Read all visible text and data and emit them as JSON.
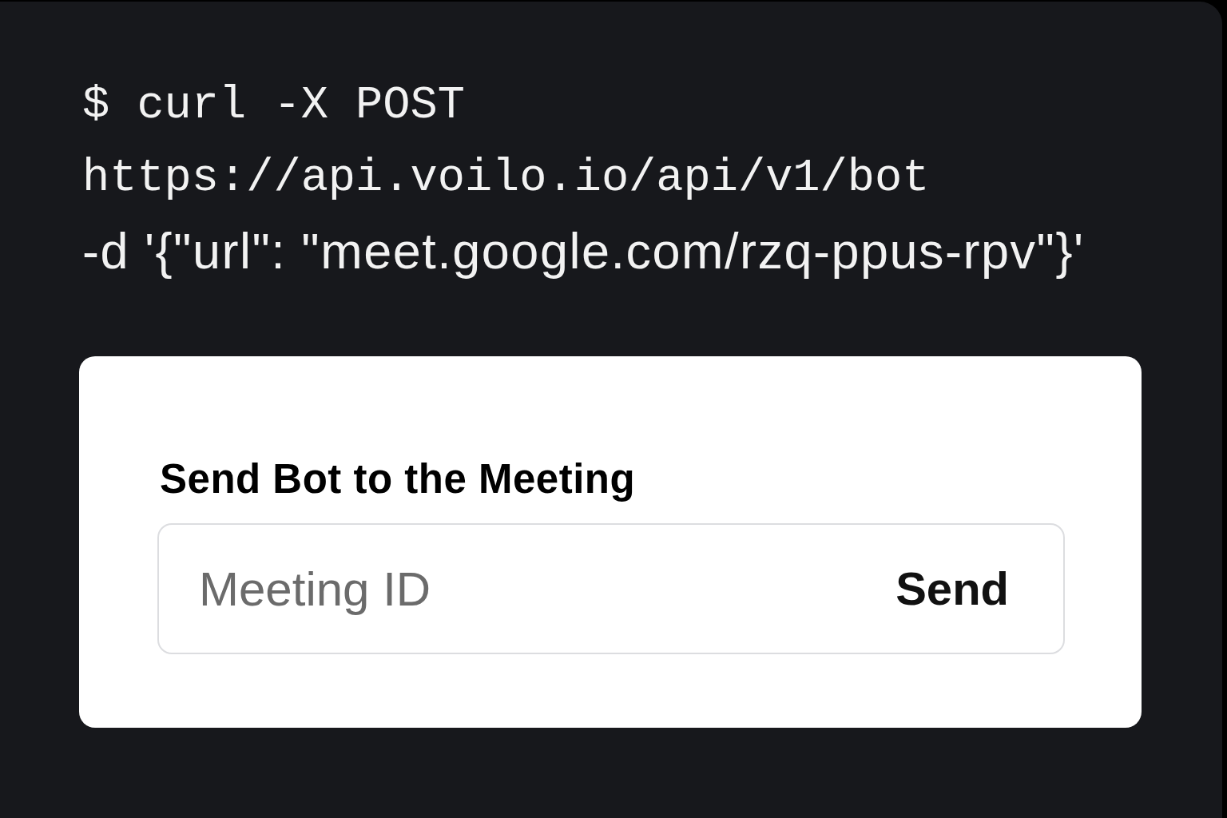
{
  "code": {
    "lines": [
      {
        "kind": "mono",
        "text": "$ curl -X POST"
      },
      {
        "kind": "mono",
        "text": "https://api.voilo.io/api/v1/bot"
      },
      {
        "kind": "sans",
        "text": "-d '{\"url\": \"meet.google.com/rzq-ppus-rpv\"}'"
      }
    ]
  },
  "card": {
    "title": "Send Bot to the Meeting",
    "input": {
      "placeholder": "Meeting ID"
    },
    "button": "Send"
  }
}
